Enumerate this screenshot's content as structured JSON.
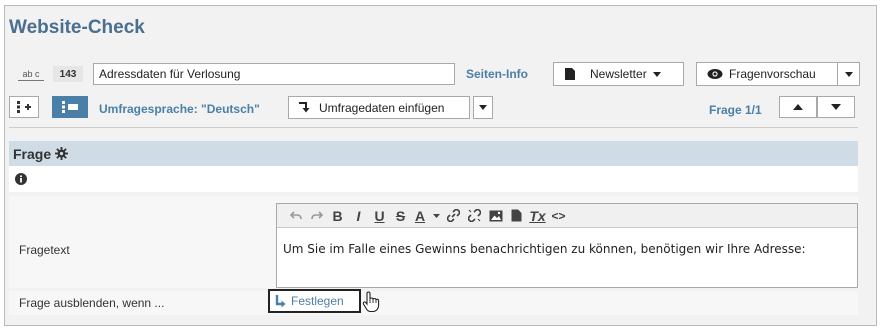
{
  "header": {
    "title": "Website-Check"
  },
  "survey": {
    "type_icon_label": "ab c",
    "id": "143",
    "name": "Adressdaten für Verlosung",
    "page_info_label": "Seiten-Info",
    "newsletter_label": "Newsletter",
    "preview_label": "Fragenvorschau"
  },
  "toolbar": {
    "language_label": "Umfragesprache: \"Deutsch\"",
    "insert_label": "Umfragedaten einfügen",
    "question_counter": "Frage 1/1"
  },
  "question": {
    "section_title": "Frage",
    "fragetext_label": "Fragetext",
    "fragetext_value": "Um Sie im Falle eines Gewinns benachrichtigen zu können, benötigen wir Ihre Adresse:",
    "hide_label": "Frage ausblenden, wenn ...",
    "festlegen_label": "Festlegen"
  },
  "editor_toolbar": {
    "bold": "B",
    "italic": "I",
    "underline": "U",
    "strike": "S",
    "font_color": "A",
    "clear_format": "Tx",
    "source": "<>"
  },
  "colors": {
    "accent": "#4a7fa8",
    "section_header_bg": "#cfdce6",
    "title": "#4a6f8f"
  }
}
